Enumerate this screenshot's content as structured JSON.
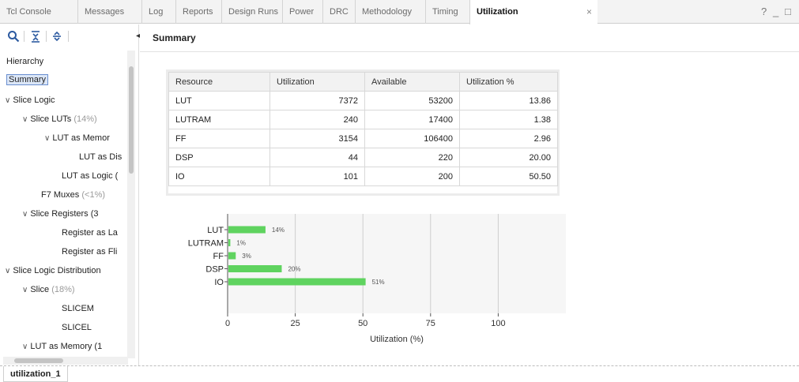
{
  "tabs": [
    {
      "label": "Tcl Console",
      "active": false
    },
    {
      "label": "Messages",
      "active": false
    },
    {
      "label": "Log",
      "active": false
    },
    {
      "label": "Reports",
      "active": false
    },
    {
      "label": "Design Runs",
      "active": false
    },
    {
      "label": "Power",
      "active": false
    },
    {
      "label": "DRC",
      "active": false
    },
    {
      "label": "Methodology",
      "active": false
    },
    {
      "label": "Timing",
      "active": false
    },
    {
      "label": "Utilization",
      "active": true
    }
  ],
  "tab_close": "×",
  "window_controls": {
    "help": "?",
    "minimize": "_",
    "maximize": "□"
  },
  "toolbar_icons": [
    "search-icon",
    "collapse-all-icon",
    "expand-all-icon"
  ],
  "tree": [
    {
      "label": "Hierarchy",
      "muted": ""
    },
    {
      "label": "Summary",
      "muted": ""
    },
    {
      "label": "Slice Logic",
      "muted": ""
    },
    {
      "label": "Slice LUTs",
      "muted": "(14%)"
    },
    {
      "label": "LUT as Memor",
      "muted": ""
    },
    {
      "label": "LUT as Dis",
      "muted": ""
    },
    {
      "label": "LUT as Logic (",
      "muted": ""
    },
    {
      "label": "F7 Muxes",
      "muted": "(<1%)"
    },
    {
      "label": "Slice Registers (3",
      "muted": ""
    },
    {
      "label": "Register as La",
      "muted": ""
    },
    {
      "label": "Register as Fli",
      "muted": ""
    },
    {
      "label": "Slice Logic Distribution",
      "muted": ""
    },
    {
      "label": "Slice",
      "muted": "(18%)"
    },
    {
      "label": "SLICEM",
      "muted": ""
    },
    {
      "label": "SLICEL",
      "muted": ""
    },
    {
      "label": "LUT as Memory (1",
      "muted": ""
    }
  ],
  "summary_title": "Summary",
  "table": {
    "headers": [
      "Resource",
      "Utilization",
      "Available",
      "Utilization %"
    ],
    "rows": [
      [
        "LUT",
        "7372",
        "53200",
        "13.86"
      ],
      [
        "LUTRAM",
        "240",
        "17400",
        "1.38"
      ],
      [
        "FF",
        "3154",
        "106400",
        "2.96"
      ],
      [
        "DSP",
        "44",
        "220",
        "20.00"
      ],
      [
        "IO",
        "101",
        "200",
        "50.50"
      ]
    ]
  },
  "chart_data": {
    "type": "bar",
    "orientation": "horizontal",
    "categories": [
      "LUT",
      "LUTRAM",
      "FF",
      "DSP",
      "IO"
    ],
    "values": [
      14,
      1,
      3,
      20,
      51
    ],
    "data_labels": [
      "14%",
      "1%",
      "3%",
      "20%",
      "51%"
    ],
    "xlabel": "Utilization (%)",
    "ylabel": "",
    "xticks": [
      "0",
      "25",
      "50",
      "75",
      "100"
    ],
    "xlim": [
      0,
      125
    ],
    "grid": true,
    "bar_color": "#5fd35f"
  },
  "bottom_tab": "utilization_1",
  "colors": {
    "accent": "#2c5aa0",
    "selection": "#dbe6f7"
  }
}
